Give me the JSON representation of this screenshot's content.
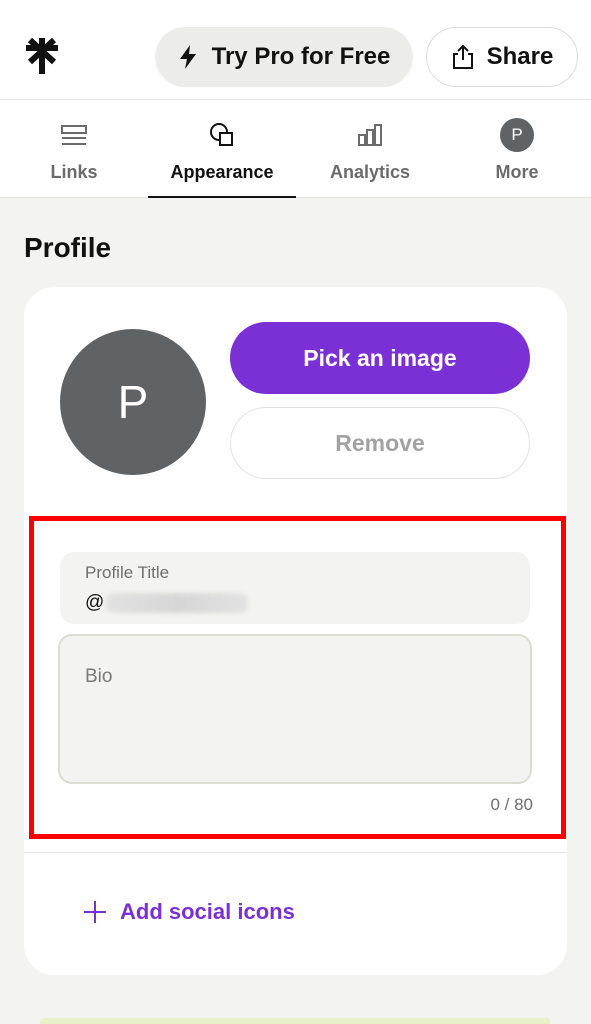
{
  "header": {
    "try_pro_label": "Try Pro for Free",
    "share_label": "Share",
    "logo_icon": "asterisk-logo-icon",
    "pro_icon": "lightning-bolt-icon",
    "share_icon": "share-upload-icon"
  },
  "tabs": [
    {
      "label": "Links",
      "icon": "links-icon",
      "active": false
    },
    {
      "label": "Appearance",
      "icon": "shapes-icon",
      "active": true
    },
    {
      "label": "Analytics",
      "icon": "bar-chart-icon",
      "active": false
    },
    {
      "label": "More",
      "icon": "avatar",
      "avatar_initial": "P",
      "active": false
    }
  ],
  "profile": {
    "section_title": "Profile",
    "avatar_initial": "P",
    "pick_image_label": "Pick an image",
    "remove_label": "Remove",
    "title_field": {
      "label": "Profile Title",
      "value_prefix": "@"
    },
    "bio_field": {
      "placeholder": "Bio"
    },
    "bio_counter": "0 / 80",
    "add_social_label": "Add social icons"
  },
  "colors": {
    "accent_purple": "#7b30d5",
    "avatar_gray": "#5f6366",
    "highlight_red": "#ff0000",
    "page_bg": "#f3f3f1"
  }
}
